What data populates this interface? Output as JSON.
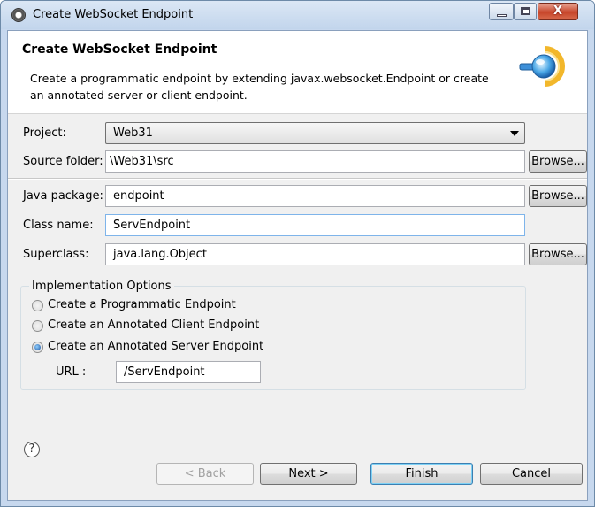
{
  "window": {
    "title": "Create WebSocket Endpoint",
    "icon": "eclipse-gear-icon",
    "controls": {
      "close": "X"
    }
  },
  "banner": {
    "title": "Create WebSocket Endpoint",
    "description": "Create a programmatic endpoint by extending javax.websocket.Endpoint or create an annotated server or client endpoint.",
    "icon": "websocket-plug-icon"
  },
  "form": {
    "project": {
      "label": "Project:",
      "value": "Web31"
    },
    "source_folder": {
      "label": "Source folder:",
      "value": "\\Web31\\src",
      "browse": "Browse..."
    },
    "java_package": {
      "label": "Java package:",
      "value": "endpoint",
      "browse": "Browse..."
    },
    "class_name": {
      "label": "Class name:",
      "value": "ServEndpoint"
    },
    "superclass": {
      "label": "Superclass:",
      "value": "java.lang.Object",
      "browse": "Browse..."
    }
  },
  "options": {
    "title": "Implementation Options",
    "items": [
      {
        "label": "Create a Programmatic Endpoint",
        "selected": false
      },
      {
        "label": "Create an Annotated Client Endpoint",
        "selected": false
      },
      {
        "label": "Create an Annotated Server Endpoint",
        "selected": true
      }
    ],
    "url": {
      "label": "URL :",
      "value": "/ServEndpoint"
    }
  },
  "footer": {
    "help": "?",
    "back": "< Back",
    "next": "Next >",
    "finish": "Finish",
    "cancel": "Cancel"
  }
}
